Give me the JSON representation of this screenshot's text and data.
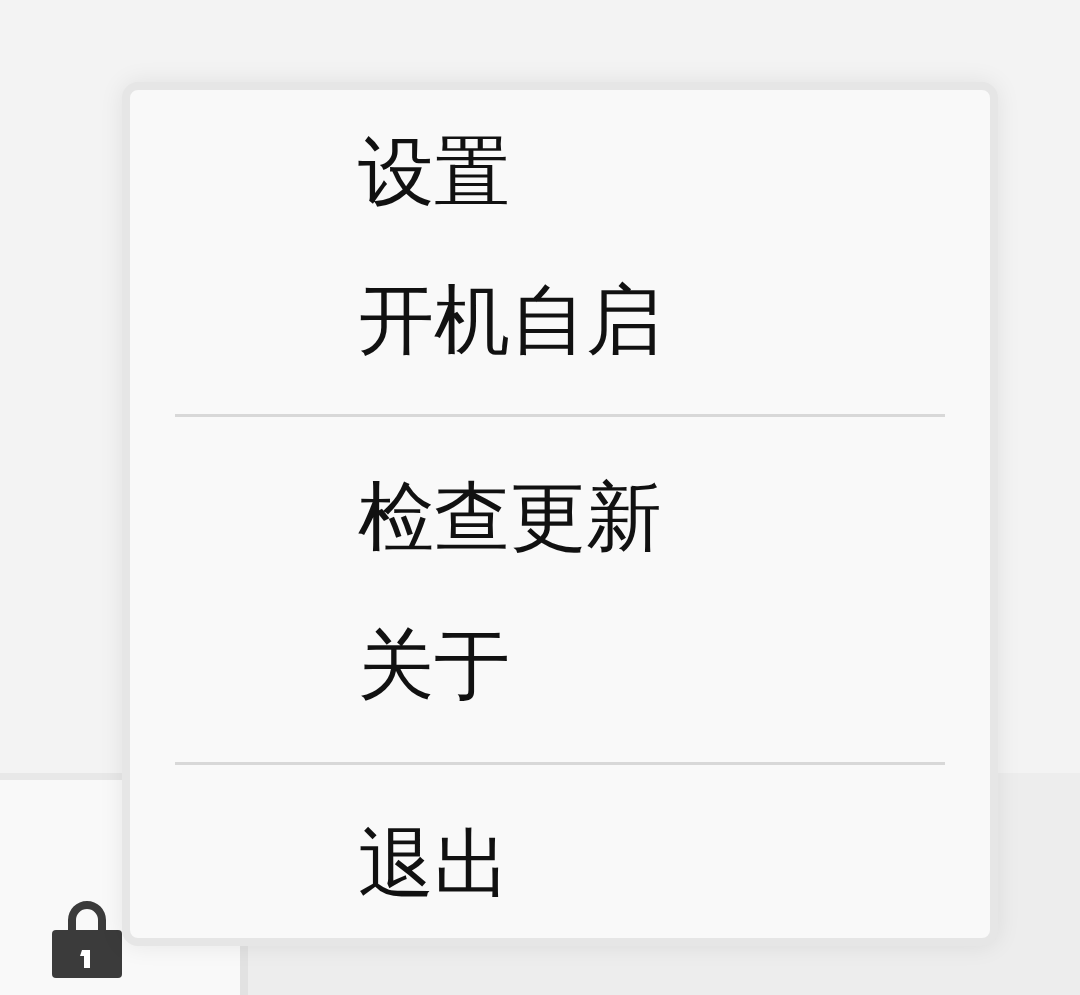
{
  "menu": {
    "sections": [
      {
        "items": [
          {
            "label": "设置"
          },
          {
            "label": "开机自启"
          }
        ]
      },
      {
        "items": [
          {
            "label": "检查更新"
          },
          {
            "label": "关于"
          }
        ]
      },
      {
        "items": [
          {
            "label": "退出"
          }
        ]
      }
    ]
  }
}
